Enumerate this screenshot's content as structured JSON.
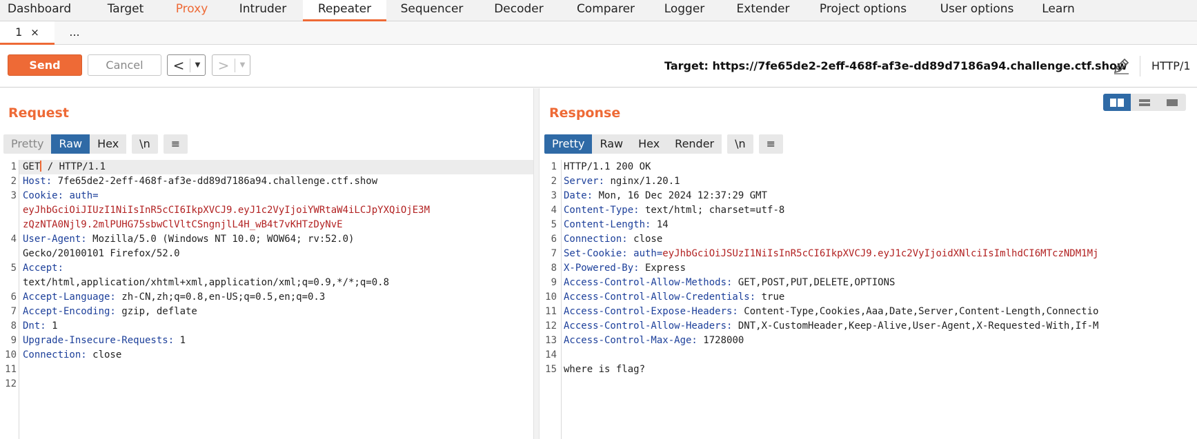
{
  "top_tabs": [
    {
      "label": "Dashboard"
    },
    {
      "label": "Target"
    },
    {
      "label": "Proxy"
    },
    {
      "label": "Intruder"
    },
    {
      "label": "Repeater"
    },
    {
      "label": "Sequencer"
    },
    {
      "label": "Decoder"
    },
    {
      "label": "Comparer"
    },
    {
      "label": "Logger"
    },
    {
      "label": "Extender"
    },
    {
      "label": "Project options"
    },
    {
      "label": "User options"
    },
    {
      "label": "Learn"
    }
  ],
  "active_top_tab": "Repeater",
  "sub_tabs": [
    {
      "label": "1",
      "close": "×"
    },
    {
      "label": "..."
    }
  ],
  "toolbar": {
    "send_label": "Send",
    "cancel_label": "Cancel",
    "back_arrow": "<",
    "forward_arrow": ">",
    "dropdown_glyph": "▼",
    "target": "Target: https://7fe65de2-2eff-468f-af3e-dd89d7186a94.challenge.ctf.show",
    "http_version": "HTTP/1"
  },
  "request": {
    "title": "Request",
    "formats": [
      "Pretty",
      "Raw",
      "Hex",
      "\\n",
      "≡"
    ],
    "active_format": "Raw",
    "line_numbers": [
      "1",
      "2",
      "3",
      "4",
      "5",
      "6",
      "7",
      "8",
      "9",
      "10",
      "11",
      "12"
    ],
    "lines": {
      "l1_method": "GET",
      "l1_rest": " / HTTP/1.1",
      "l2_key": "Host:",
      "l2_val": " 7fe65de2-2eff-468f-af3e-dd89d7186a94.challenge.ctf.show",
      "l3_key": "Cookie:",
      "l3_ckey": " auth=",
      "l3_cval_a": "eyJhbGciOiJIUzI1NiIsInR5cCI6IkpXVCJ9.eyJ1c2VyIjoiYWRtaW4iLCJpYXQiOjE3M",
      "l3_cval_b": "zQzNTA0Njl9.2mlPUHG75sbwClVltCSngnjlL4H_wB4t7vKHTzDyNvE",
      "l4_key": "User-Agent:",
      "l4_val": " Mozilla/5.0 (Windows NT 10.0; WOW64; rv:52.0)",
      "l4_cont": "Gecko/20100101 Firefox/52.0",
      "l5_key": "Accept:",
      "l5_cont": "text/html,application/xhtml+xml,application/xml;q=0.9,*/*;q=0.8",
      "l6_key": "Accept-Language:",
      "l6_val": " zh-CN,zh;q=0.8,en-US;q=0.5,en;q=0.3",
      "l7_key": "Accept-Encoding:",
      "l7_val": " gzip, deflate",
      "l8_key": "Dnt:",
      "l8_val": " 1",
      "l9_key": "Upgrade-Insecure-Requests:",
      "l9_val": " 1",
      "l10_key": "Connection:",
      "l10_val": " close"
    }
  },
  "response": {
    "title": "Response",
    "formats": [
      "Pretty",
      "Raw",
      "Hex",
      "Render",
      "\\n",
      "≡"
    ],
    "active_format": "Pretty",
    "line_numbers": [
      "1",
      "2",
      "3",
      "4",
      "5",
      "6",
      "7",
      "8",
      "9",
      "10",
      "11",
      "12",
      "13",
      "14",
      "15"
    ],
    "lines": {
      "l1": "HTTP/1.1 200 OK",
      "l2_key": "Server:",
      "l2_val": " nginx/1.20.1",
      "l3_key": "Date:",
      "l3_val": " Mon, 16 Dec 2024 12:37:29 GMT",
      "l4_key": "Content-Type:",
      "l4_val": " text/html; charset=utf-8",
      "l5_key": "Content-Length:",
      "l5_val": " 14",
      "l6_key": "Connection:",
      "l6_val": " close",
      "l7_key": "Set-Cookie:",
      "l7_ckey": " auth=",
      "l7_cval": "eyJhbGciOiJSUzI1NiIsInR5cCI6IkpXVCJ9.eyJ1c2VyIjoidXNlciIsImlhdCI6MTczNDM1Mj",
      "l8_key": "X-Powered-By:",
      "l8_val": " Express",
      "l9_key": "Access-Control-Allow-Methods:",
      "l9_val": " GET,POST,PUT,DELETE,OPTIONS",
      "l10_key": "Access-Control-Allow-Credentials:",
      "l10_val": " true",
      "l11_key": "Access-Control-Expose-Headers:",
      "l11_val": " Content-Type,Cookies,Aaa,Date,Server,Content-Length,Connectio",
      "l12_key": "Access-Control-Allow-Headers:",
      "l12_val": " DNT,X-CustomHeader,Keep-Alive,User-Agent,X-Requested-With,If-M",
      "l13_key": "Access-Control-Max-Age:",
      "l13_val": " 1728000",
      "l15": "where is flag?"
    }
  }
}
